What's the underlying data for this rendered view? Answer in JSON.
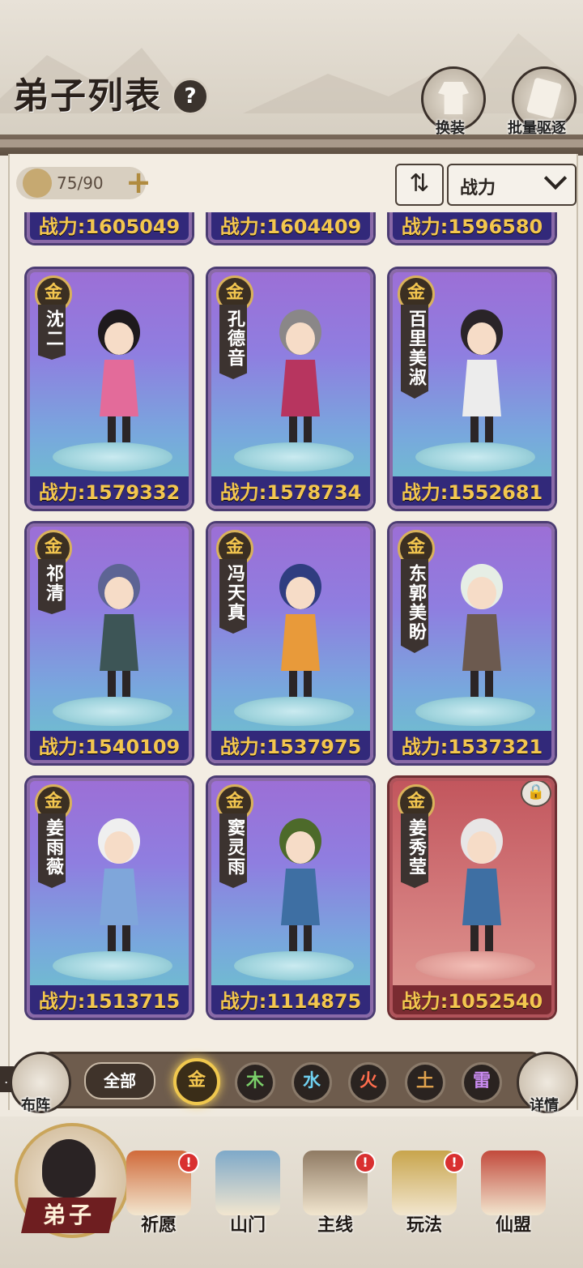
{
  "header": {
    "title": "弟子列表",
    "help": "?",
    "buttons": [
      {
        "label": "换装",
        "icon": "robe-icon"
      },
      {
        "label": "批量驱逐",
        "icon": "dismiss-scroll-icon"
      }
    ]
  },
  "toolbar": {
    "count": "75/90",
    "sort_value": "战力",
    "sort_icon": "⇅"
  },
  "top_partial_powers": [
    "战力:1605049",
    "战力:1604409",
    "战力:1596580"
  ],
  "disciples": [
    {
      "rank": "金",
      "name": "沈二",
      "power": "战力:1579332",
      "hair": "#1e1a1d",
      "outfit": "#e36b9a",
      "theme": "purple"
    },
    {
      "rank": "金",
      "name": "孔德音",
      "power": "战力:1578734",
      "hair": "#8a8788",
      "outfit": "#b7355f",
      "theme": "purple"
    },
    {
      "rank": "金",
      "name": "百里美淑",
      "power": "战力:1552681",
      "hair": "#2a2428",
      "outfit": "#ececec",
      "theme": "purple"
    },
    {
      "rank": "金",
      "name": "祁清",
      "power": "战力:1540109",
      "hair": "#5d6494",
      "outfit": "#3d5556",
      "theme": "purple"
    },
    {
      "rank": "金",
      "name": "冯天真",
      "power": "战力:1537975",
      "hair": "#2f3d80",
      "outfit": "#e89a3a",
      "theme": "purple"
    },
    {
      "rank": "金",
      "name": "东郭美盼",
      "power": "战力:1537321",
      "hair": "#e6eee5",
      "outfit": "#6c5a4f",
      "theme": "purple"
    },
    {
      "rank": "金",
      "name": "姜雨薇",
      "power": "战力:1513715",
      "hair": "#efefef",
      "outfit": "#7fa6da",
      "theme": "purple"
    },
    {
      "rank": "金",
      "name": "窦灵雨",
      "power": "战力:1114875",
      "hair": "#4d6a2a",
      "outfit": "#3e6fa3",
      "theme": "purple"
    },
    {
      "rank": "金",
      "name": "姜秀莹",
      "power": "战力:1052540",
      "hair": "#e8e6e6",
      "outfit": "#3e6fa3",
      "theme": "red"
    }
  ],
  "filter": {
    "left_button": "布阵",
    "right_button": "详情",
    "all_label": "全部",
    "elements": [
      {
        "label": "金",
        "color": "#f3c64f",
        "active": true
      },
      {
        "label": "木",
        "color": "#7bd06a",
        "active": false
      },
      {
        "label": "水",
        "color": "#6fd0f0",
        "active": false
      },
      {
        "label": "火",
        "color": "#ff6d4d",
        "active": false
      },
      {
        "label": "土",
        "color": "#e0a24d",
        "active": false
      },
      {
        "label": "雷",
        "color": "#c98bf0",
        "active": false
      }
    ]
  },
  "bottom_nav": [
    {
      "label": "弟子",
      "active": true,
      "badge": false,
      "icon": "disciple-icon"
    },
    {
      "label": "祈愿",
      "active": false,
      "badge": true,
      "icon": "wish-scroll-icon"
    },
    {
      "label": "山门",
      "active": false,
      "badge": false,
      "icon": "gate-icon"
    },
    {
      "label": "主线",
      "active": false,
      "badge": true,
      "icon": "sword-icon"
    },
    {
      "label": "玩法",
      "active": false,
      "badge": true,
      "icon": "gameplay-icon"
    },
    {
      "label": "仙盟",
      "active": false,
      "badge": false,
      "icon": "alliance-icon"
    }
  ],
  "badge_text": "!",
  "lock_icon": "🔒"
}
